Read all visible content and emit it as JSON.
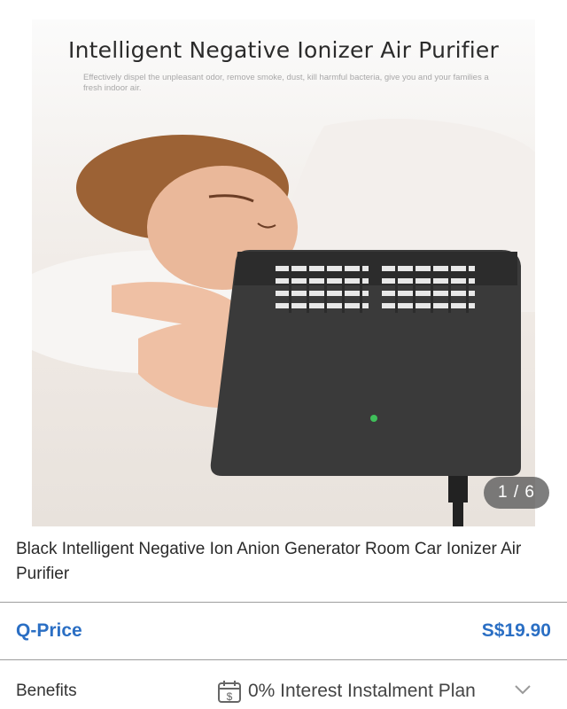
{
  "gallery": {
    "image_title": "Intelligent Negative Ionizer Air Purifier",
    "image_subtitle": "Effectively dispel the unpleasant odor, remove smoke, dust, kill harmful bacteria, give you and your families a fresh indoor air.",
    "counter": "1 / 6"
  },
  "product": {
    "title": "Black Intelligent Negative Ion Anion Generator Room Car Ionizer Air Purifier"
  },
  "price": {
    "label": "Q-Price",
    "value": "S$19.90",
    "accent_color": "#2b6fc4"
  },
  "benefits": {
    "label": "Benefits",
    "value": "0% Interest Instalment Plan",
    "icon": "calendar-dollar-icon",
    "expand_icon": "chevron-down-icon"
  }
}
